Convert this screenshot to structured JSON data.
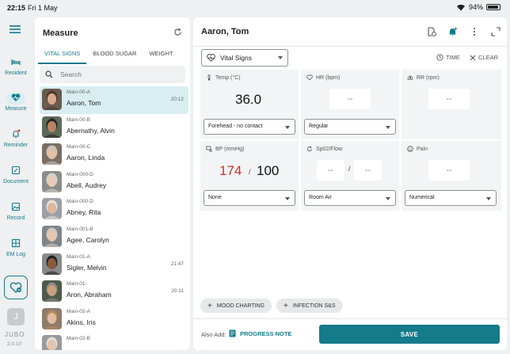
{
  "status": {
    "time": "22:15",
    "date": "Fri 1 May",
    "battery": "94%"
  },
  "colors": {
    "accent": "#157a8a",
    "bp_high": "#d32f2f"
  },
  "rail": {
    "items": [
      {
        "label": "Resident",
        "icon": "bed-icon"
      },
      {
        "label": "Measure",
        "icon": "heart-pulse-icon"
      },
      {
        "label": "Reminder",
        "icon": "bell-icon"
      },
      {
        "label": "Document",
        "icon": "edit-document-icon"
      },
      {
        "label": "Record",
        "icon": "image-icon"
      },
      {
        "label": "EM Log",
        "icon": "grid-icon"
      }
    ],
    "avatar_initial": "J",
    "brand": "JUBO",
    "version": "2.0.10"
  },
  "list": {
    "title": "Measure",
    "tabs": [
      "VITAL SIGNS",
      "BLOOD SUGAR",
      "WEIGHT"
    ],
    "search_placeholder": "Search",
    "residents": [
      {
        "code": "Main-00-A",
        "name": "Aaron, Tom",
        "time": "20:12"
      },
      {
        "code": "Main-00-B",
        "name": "Abernathy, Alvin",
        "time": ""
      },
      {
        "code": "Main-00-C",
        "name": "Aaron, Linda",
        "time": ""
      },
      {
        "code": "Main-000-D",
        "name": "Abell, Audrey",
        "time": ""
      },
      {
        "code": "Main-000-D",
        "name": "Abney, Rita",
        "time": ""
      },
      {
        "code": "Main-001-B",
        "name": "Agee, Carolyn",
        "time": ""
      },
      {
        "code": "Main-01-A",
        "name": "Sigler, Melvin",
        "time": "21:47"
      },
      {
        "code": "Main-01-",
        "name": "Aron, Abraham",
        "time": "20:11"
      },
      {
        "code": "Main-02-A",
        "name": "Akins, Iris",
        "time": ""
      },
      {
        "code": "Main-02-B",
        "name": "",
        "time": ""
      }
    ]
  },
  "main": {
    "patient_name": "Aaron, Tom",
    "type_select": "Vital Signs",
    "time_btn": "TIME",
    "clear_btn": "CLEAR",
    "temp": {
      "label": "Temp (°C)",
      "value": "36.0",
      "method": "Forehead - no contact"
    },
    "hr": {
      "label": "HR (bpm)",
      "value": "--",
      "rhythm": "Regular"
    },
    "rr": {
      "label": "RR (rpm)",
      "value": "--"
    },
    "bp": {
      "label": "BP (mmHg)",
      "systolic": "174",
      "sep": "/",
      "diastolic": "100",
      "position": "None"
    },
    "spo2": {
      "label": "Sp02/Flow",
      "spo2": "--",
      "sep": "/",
      "flow": "--",
      "source": "Room Air"
    },
    "pain": {
      "label": "Pain",
      "value": "--",
      "scale": "Numerical"
    },
    "chips": [
      "MOOD CHARTING",
      "INFECTION S&S"
    ],
    "also_add": "Also Add:",
    "progress_note": "PROGRESS NOTE",
    "save": "SAVE"
  }
}
